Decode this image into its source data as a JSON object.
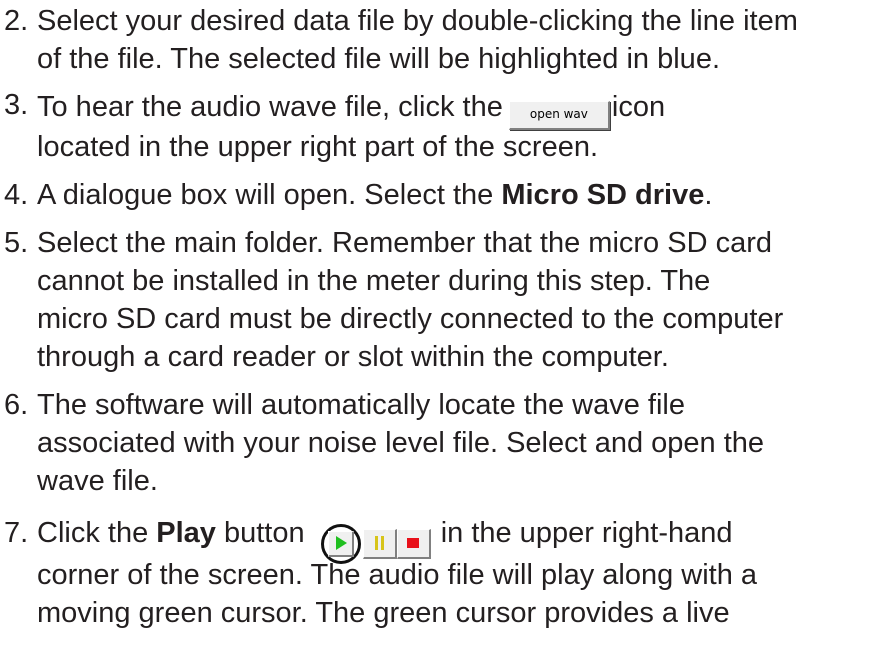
{
  "steps": [
    {
      "number": "2.",
      "lines": [
        "Select your desired data file by double-clicking the line item",
        "of the file. The selected file will be highlighted in blue."
      ]
    },
    {
      "number": "3.",
      "line1_before": "To hear the audio wave file, click the",
      "button_label": "open wav",
      "line1_after": "icon",
      "line2": "located in the upper right part of the screen."
    },
    {
      "number": "4.",
      "text_before": "A dialogue box will open. Select the ",
      "bold": "Micro SD drive",
      "text_after": "."
    },
    {
      "number": "5.",
      "lines": [
        "Select the main folder. Remember that the micro SD card",
        "cannot be installed in the meter during this step. The",
        "micro SD card must be directly connected to the computer",
        "through a card reader or slot within the computer."
      ]
    },
    {
      "number": "6.",
      "lines": [
        "The software will automatically locate the wave file",
        "associated with your noise level file. Select and open the",
        "wave file."
      ]
    },
    {
      "number": "7.",
      "text_before": "Click the ",
      "bold": "Play",
      "text_mid": " button",
      "text_after": "in the upper right-hand",
      "line2": "corner of the screen. The audio file will play along with a",
      "line3": "moving green cursor. The green cursor provides a live"
    }
  ],
  "icons": {
    "play": "play-icon",
    "pause": "pause-icon",
    "stop": "stop-icon"
  },
  "colors": {
    "text": "#231f20",
    "play": "#1fbf1f",
    "pause": "#d7c41a",
    "stop": "#e8101a"
  }
}
